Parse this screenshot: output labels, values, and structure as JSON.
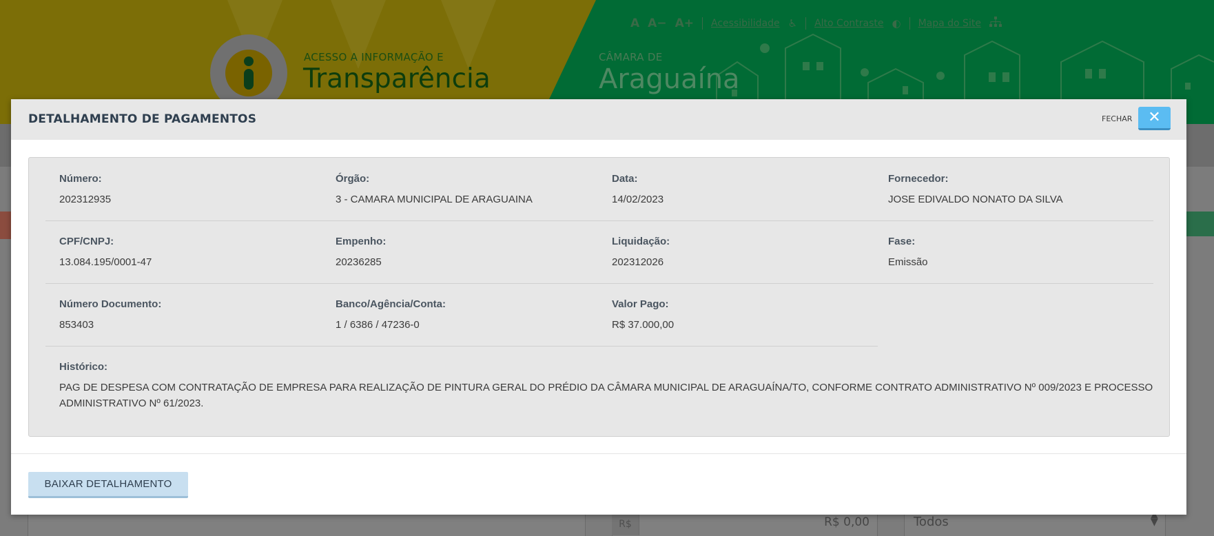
{
  "site": {
    "logo_subtitle": "ACESSO A INFORMAÇÃO E",
    "logo_title": "Transparência",
    "city_subtitle": "CÂMARA DE",
    "city_title": "Araguaína",
    "font_normal": "A",
    "font_decrease": "A−",
    "font_increase": "A+",
    "accessibility_label": "Acessibilidade",
    "high_contrast_label": "Alto Contraste",
    "sitemap_label": "Mapa do Site"
  },
  "background_form": {
    "currency_prefix": "R$",
    "amount_value": "R$ 0,00",
    "select_value": "Todos"
  },
  "modal": {
    "title": "DETALHAMENTO DE PAGAMENTOS",
    "close_label": "FECHAR",
    "close_icon": "close-icon",
    "download_label": "BAIXAR DETALHAMENTO",
    "fields": {
      "numero": {
        "label": "Número:",
        "value": "202312935"
      },
      "orgao": {
        "label": "Órgão:",
        "value": "3 - CAMARA MUNICIPAL DE ARAGUAINA"
      },
      "data": {
        "label": "Data:",
        "value": "14/02/2023"
      },
      "fornecedor": {
        "label": "Fornecedor:",
        "value": "JOSE EDIVALDO NONATO DA SILVA"
      },
      "cpf_cnpj": {
        "label": "CPF/CNPJ:",
        "value": "13.084.195/0001-47"
      },
      "empenho": {
        "label": "Empenho:",
        "value": "20236285"
      },
      "liquidacao": {
        "label": "Liquidação:",
        "value": "202312026"
      },
      "fase": {
        "label": "Fase:",
        "value": "Emissão"
      },
      "numero_documento": {
        "label": "Número Documento:",
        "value": "853403"
      },
      "banco": {
        "label": "Banco/Agência/Conta:",
        "value": "1 / 6386 / 47236-0"
      },
      "valor_pago": {
        "label": "Valor Pago:",
        "value": "R$ 37.000,00"
      },
      "historico": {
        "label": "Histórico:",
        "value": "PAG DE DESPESA COM CONTRATAÇÃO DE EMPRESA PARA REALIZAÇÃO DE PINTURA GERAL DO PRÉDIO DA CÂMARA MUNICIPAL DE ARAGUAÍNA/TO, CONFORME CONTRATO ADMINISTRATIVO Nº 009/2023 E PROCESSO ADMINISTRATIVO Nº 61/2023."
      }
    }
  },
  "colors": {
    "header_yellow": "#7c6e07",
    "header_green": "#016b35",
    "close_button": "#5bbcf2",
    "download_button": "#c8dff0"
  }
}
